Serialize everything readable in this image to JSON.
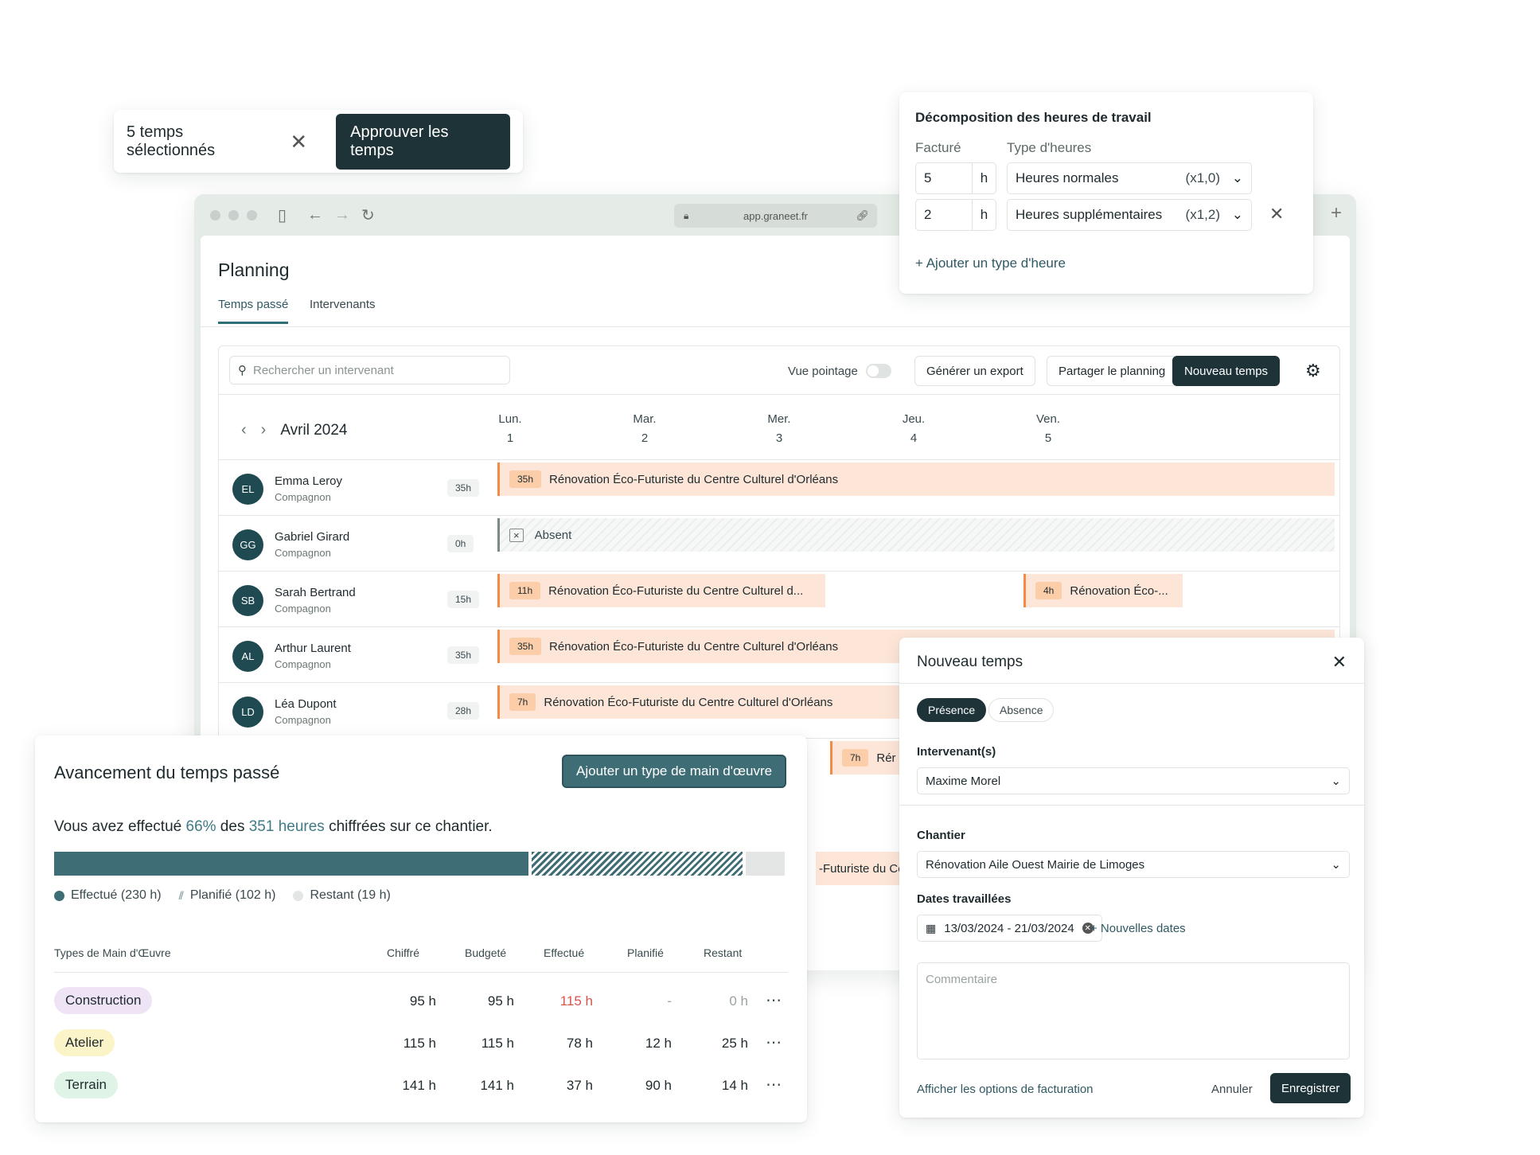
{
  "selection_bar": {
    "count_label": "5 temps sélectionnés",
    "approve_label": "Approuver les temps"
  },
  "browser": {
    "url": "app.graneet.fr"
  },
  "planning": {
    "title": "Planning",
    "tabs": [
      {
        "label": "Temps passé",
        "active": true
      },
      {
        "label": "Intervenants",
        "active": false
      }
    ],
    "search_placeholder": "Rechercher un intervenant",
    "vue_pointage_label": "Vue pointage",
    "vue_pointage_on": false,
    "export_label": "Générer un export",
    "share_label": "Partager le planning",
    "new_label": "Nouveau temps",
    "month": "Avril 2024",
    "days": [
      {
        "name": "Lun.",
        "num": "1"
      },
      {
        "name": "Mar.",
        "num": "2"
      },
      {
        "name": "Mer.",
        "num": "3"
      },
      {
        "name": "Jeu.",
        "num": "4"
      },
      {
        "name": "Ven.",
        "num": "5"
      }
    ],
    "workers": [
      {
        "initials": "EL",
        "name": "Emma Leroy",
        "role": "Compagnon",
        "hours": "35h",
        "bars": [
          {
            "hours": "35h",
            "label": "Rénovation Éco-Futuriste du Centre Culturel d'Orléans"
          }
        ]
      },
      {
        "initials": "GG",
        "name": "Gabriel Girard",
        "role": "Compagnon",
        "hours": "0h",
        "absent_label": "Absent"
      },
      {
        "initials": "SB",
        "name": "Sarah Bertrand",
        "role": "Compagnon",
        "hours": "15h",
        "bars": [
          {
            "hours": "11h",
            "label": "Rénovation Éco-Futuriste du Centre Culturel d..."
          },
          {
            "hours": "4h",
            "label": "Rénovation Éco-..."
          }
        ]
      },
      {
        "initials": "AL",
        "name": "Arthur Laurent",
        "role": "Compagnon",
        "hours": "35h",
        "bars": [
          {
            "hours": "35h",
            "label": "Rénovation Éco-Futuriste du Centre Culturel d'Orléans"
          }
        ]
      },
      {
        "initials": "LD",
        "name": "Léa Dupont",
        "role": "Compagnon",
        "hours": "28h",
        "bars": [
          {
            "hours": "7h",
            "label": "Rénovation Éco-Futuriste du Centre Culturel d'Orléans"
          }
        ]
      }
    ],
    "partial_bars": [
      {
        "hours": "7h",
        "label": "Rér"
      },
      {
        "label": "-Futuriste du Cer"
      }
    ]
  },
  "decomposition": {
    "title": "Décomposition des heures de travail",
    "col_facture": "Facturé",
    "col_type": "Type d'heures",
    "rows": [
      {
        "value": "5",
        "unit": "h",
        "type": "Heures normales",
        "multiplier": "(x1,0)"
      },
      {
        "value": "2",
        "unit": "h",
        "type": "Heures supplémentaires",
        "multiplier": "(x1,2)"
      }
    ],
    "add_label": "+ Ajouter un type d'heure"
  },
  "avancement": {
    "title": "Avancement du temps passé",
    "add_button": "Ajouter un type de main d'œuvre",
    "sentence_pre": "Vous avez effectué ",
    "percent": "66%",
    "sentence_mid": " des ",
    "hours": "351 heures",
    "sentence_post": " chiffrées sur ce chantier.",
    "progress": {
      "done": 230,
      "planned": 102,
      "remaining": 19
    },
    "legend": {
      "done": "Effectué (230 h)",
      "planned": "Planifié (102 h)",
      "remaining": "Restant (19 h)"
    },
    "columns": [
      "Types de Main d'Œuvre",
      "Chiffré",
      "Budgeté",
      "Effectué",
      "Planifié",
      "Restant"
    ],
    "rows": [
      {
        "type": "Construction",
        "color": "#efe4f6",
        "chiffre": "95 h",
        "budgete": "95 h",
        "effectue": "115 h",
        "effectue_over": true,
        "planifie": "-",
        "restant": "0 h"
      },
      {
        "type": "Atelier",
        "color": "#fbf4c8",
        "chiffre": "115 h",
        "budgete": "115 h",
        "effectue": "78 h",
        "effectue_over": false,
        "planifie": "12 h",
        "restant": "25 h"
      },
      {
        "type": "Terrain",
        "color": "#dff3e6",
        "chiffre": "141 h",
        "budgete": "141 h",
        "effectue": "37 h",
        "effectue_over": false,
        "planifie": "90 h",
        "restant": "14 h"
      }
    ],
    "more_icon": "⋯"
  },
  "nouveau_temps": {
    "title": "Nouveau temps",
    "seg_presence": "Présence",
    "seg_absence": "Absence",
    "intervenants_label": "Intervenant(s)",
    "intervenant_value": "Maxime Morel",
    "chantier_label": "Chantier",
    "chantier_value": "Rénovation Aile Ouest Mairie de Limoges",
    "dates_label": "Dates travaillées",
    "dates_value": "13/03/2024 - 21/03/2024",
    "new_dates": "+ Nouvelles dates",
    "comment_placeholder": "Commentaire",
    "billing_link": "Afficher les options de facturation",
    "cancel_label": "Annuler",
    "save_label": "Enregistrer"
  },
  "colors": {
    "primary_dark": "#1e3338",
    "teal": "#3f6d76",
    "bar_bg": "#fde6d8",
    "bar_accent": "#f28b46",
    "over_budget": "#d9534f"
  }
}
